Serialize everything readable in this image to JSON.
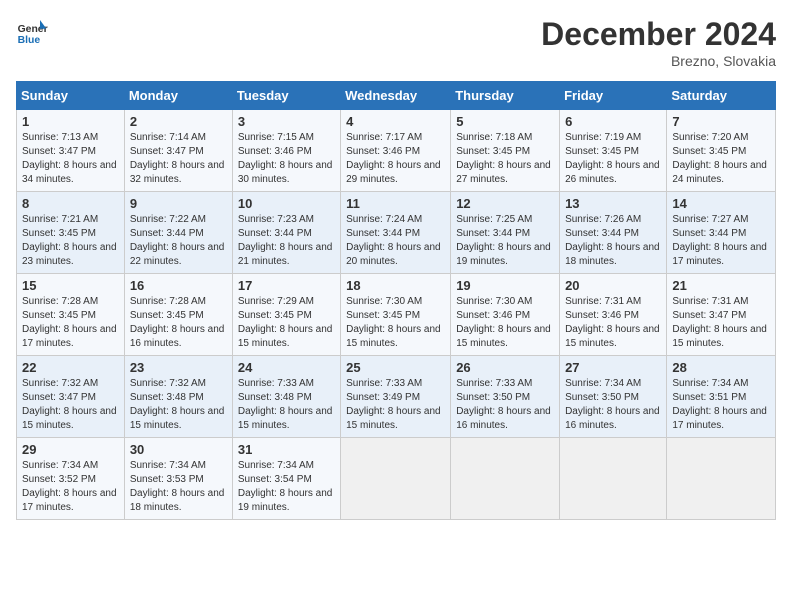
{
  "logo": {
    "line1": "General",
    "line2": "Blue"
  },
  "title": "December 2024",
  "location": "Brezno, Slovakia",
  "headers": [
    "Sunday",
    "Monday",
    "Tuesday",
    "Wednesday",
    "Thursday",
    "Friday",
    "Saturday"
  ],
  "weeks": [
    [
      {
        "day": "1",
        "sunrise": "7:13 AM",
        "sunset": "3:47 PM",
        "daylight": "8 hours and 34 minutes."
      },
      {
        "day": "2",
        "sunrise": "7:14 AM",
        "sunset": "3:47 PM",
        "daylight": "8 hours and 32 minutes."
      },
      {
        "day": "3",
        "sunrise": "7:15 AM",
        "sunset": "3:46 PM",
        "daylight": "8 hours and 30 minutes."
      },
      {
        "day": "4",
        "sunrise": "7:17 AM",
        "sunset": "3:46 PM",
        "daylight": "8 hours and 29 minutes."
      },
      {
        "day": "5",
        "sunrise": "7:18 AM",
        "sunset": "3:45 PM",
        "daylight": "8 hours and 27 minutes."
      },
      {
        "day": "6",
        "sunrise": "7:19 AM",
        "sunset": "3:45 PM",
        "daylight": "8 hours and 26 minutes."
      },
      {
        "day": "7",
        "sunrise": "7:20 AM",
        "sunset": "3:45 PM",
        "daylight": "8 hours and 24 minutes."
      }
    ],
    [
      {
        "day": "8",
        "sunrise": "7:21 AM",
        "sunset": "3:45 PM",
        "daylight": "8 hours and 23 minutes."
      },
      {
        "day": "9",
        "sunrise": "7:22 AM",
        "sunset": "3:44 PM",
        "daylight": "8 hours and 22 minutes."
      },
      {
        "day": "10",
        "sunrise": "7:23 AM",
        "sunset": "3:44 PM",
        "daylight": "8 hours and 21 minutes."
      },
      {
        "day": "11",
        "sunrise": "7:24 AM",
        "sunset": "3:44 PM",
        "daylight": "8 hours and 20 minutes."
      },
      {
        "day": "12",
        "sunrise": "7:25 AM",
        "sunset": "3:44 PM",
        "daylight": "8 hours and 19 minutes."
      },
      {
        "day": "13",
        "sunrise": "7:26 AM",
        "sunset": "3:44 PM",
        "daylight": "8 hours and 18 minutes."
      },
      {
        "day": "14",
        "sunrise": "7:27 AM",
        "sunset": "3:44 PM",
        "daylight": "8 hours and 17 minutes."
      }
    ],
    [
      {
        "day": "15",
        "sunrise": "7:28 AM",
        "sunset": "3:45 PM",
        "daylight": "8 hours and 17 minutes."
      },
      {
        "day": "16",
        "sunrise": "7:28 AM",
        "sunset": "3:45 PM",
        "daylight": "8 hours and 16 minutes."
      },
      {
        "day": "17",
        "sunrise": "7:29 AM",
        "sunset": "3:45 PM",
        "daylight": "8 hours and 15 minutes."
      },
      {
        "day": "18",
        "sunrise": "7:30 AM",
        "sunset": "3:45 PM",
        "daylight": "8 hours and 15 minutes."
      },
      {
        "day": "19",
        "sunrise": "7:30 AM",
        "sunset": "3:46 PM",
        "daylight": "8 hours and 15 minutes."
      },
      {
        "day": "20",
        "sunrise": "7:31 AM",
        "sunset": "3:46 PM",
        "daylight": "8 hours and 15 minutes."
      },
      {
        "day": "21",
        "sunrise": "7:31 AM",
        "sunset": "3:47 PM",
        "daylight": "8 hours and 15 minutes."
      }
    ],
    [
      {
        "day": "22",
        "sunrise": "7:32 AM",
        "sunset": "3:47 PM",
        "daylight": "8 hours and 15 minutes."
      },
      {
        "day": "23",
        "sunrise": "7:32 AM",
        "sunset": "3:48 PM",
        "daylight": "8 hours and 15 minutes."
      },
      {
        "day": "24",
        "sunrise": "7:33 AM",
        "sunset": "3:48 PM",
        "daylight": "8 hours and 15 minutes."
      },
      {
        "day": "25",
        "sunrise": "7:33 AM",
        "sunset": "3:49 PM",
        "daylight": "8 hours and 15 minutes."
      },
      {
        "day": "26",
        "sunrise": "7:33 AM",
        "sunset": "3:50 PM",
        "daylight": "8 hours and 16 minutes."
      },
      {
        "day": "27",
        "sunrise": "7:34 AM",
        "sunset": "3:50 PM",
        "daylight": "8 hours and 16 minutes."
      },
      {
        "day": "28",
        "sunrise": "7:34 AM",
        "sunset": "3:51 PM",
        "daylight": "8 hours and 17 minutes."
      }
    ],
    [
      {
        "day": "29",
        "sunrise": "7:34 AM",
        "sunset": "3:52 PM",
        "daylight": "8 hours and 17 minutes."
      },
      {
        "day": "30",
        "sunrise": "7:34 AM",
        "sunset": "3:53 PM",
        "daylight": "8 hours and 18 minutes."
      },
      {
        "day": "31",
        "sunrise": "7:34 AM",
        "sunset": "3:54 PM",
        "daylight": "8 hours and 19 minutes."
      },
      null,
      null,
      null,
      null
    ]
  ]
}
